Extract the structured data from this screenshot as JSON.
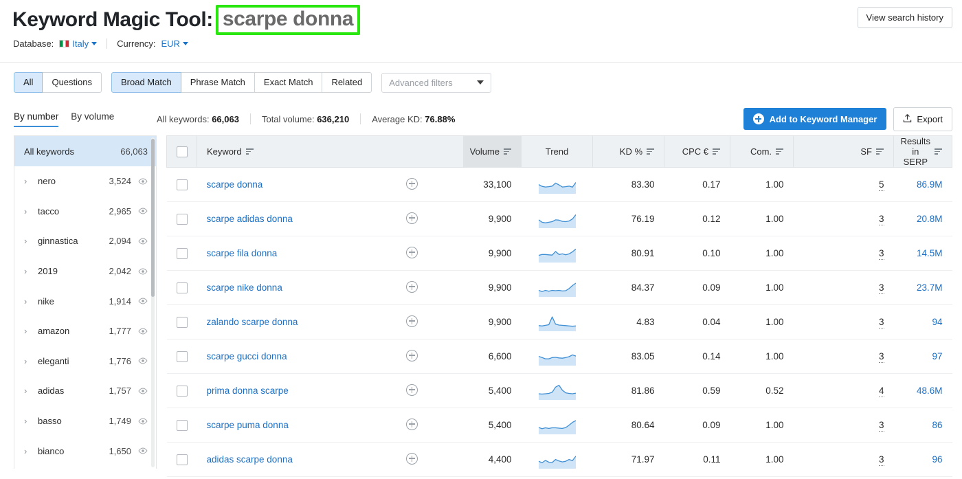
{
  "header": {
    "title_prefix": "Keyword Magic Tool:",
    "query": "scarpe donna",
    "view_history_label": "View search history",
    "highlight_color": "#2ae60f",
    "accent_color": "#1f80d8",
    "link_color": "#1b6fc4",
    "database_label": "Database:",
    "database_value": "Italy",
    "currency_label": "Currency:",
    "currency_value": "EUR"
  },
  "filters": {
    "group_one": [
      {
        "label": "All",
        "active": true
      },
      {
        "label": "Questions",
        "active": false
      }
    ],
    "group_two": [
      {
        "label": "Broad Match",
        "active": true
      },
      {
        "label": "Phrase Match",
        "active": false
      },
      {
        "label": "Exact Match",
        "active": false
      },
      {
        "label": "Related",
        "active": false
      }
    ],
    "advanced_filters_placeholder": "Advanced filters"
  },
  "stats": {
    "tabs": [
      {
        "label": "By number",
        "active": true
      },
      {
        "label": "By volume",
        "active": false
      }
    ],
    "all_keywords_label": "All keywords:",
    "all_keywords_value": "66,063",
    "total_volume_label": "Total volume:",
    "total_volume_value": "636,210",
    "average_kd_label": "Average KD:",
    "average_kd_value": "76.88%",
    "add_to_manager_label": "Add to Keyword Manager",
    "export_label": "Export"
  },
  "sidebar": {
    "all_label": "All keywords",
    "all_count": "66,063",
    "items": [
      {
        "label": "nero",
        "count": "3,524"
      },
      {
        "label": "tacco",
        "count": "2,965"
      },
      {
        "label": "ginnastica",
        "count": "2,094"
      },
      {
        "label": "2019",
        "count": "2,042"
      },
      {
        "label": "nike",
        "count": "1,914"
      },
      {
        "label": "amazon",
        "count": "1,777"
      },
      {
        "label": "eleganti",
        "count": "1,776"
      },
      {
        "label": "adidas",
        "count": "1,757"
      },
      {
        "label": "basso",
        "count": "1,749"
      },
      {
        "label": "bianco",
        "count": "1,650"
      }
    ]
  },
  "table": {
    "columns": [
      {
        "key": "keyword",
        "label": "Keyword",
        "sortable": true,
        "align": "left",
        "sorted": false
      },
      {
        "key": "volume",
        "label": "Volume",
        "sortable": true,
        "align": "right",
        "sorted": true
      },
      {
        "key": "trend",
        "label": "Trend",
        "sortable": false,
        "align": "center",
        "sorted": false
      },
      {
        "key": "kd",
        "label": "KD %",
        "sortable": true,
        "align": "right",
        "sorted": false
      },
      {
        "key": "cpc",
        "label": "CPC €",
        "sortable": true,
        "align": "right",
        "sorted": false
      },
      {
        "key": "com",
        "label": "Com.",
        "sortable": true,
        "align": "right",
        "sorted": false
      },
      {
        "key": "sf",
        "label": "SF",
        "sortable": true,
        "align": "right",
        "sorted": false
      },
      {
        "key": "serp",
        "label": "Results in SERP",
        "sortable": true,
        "align": "right",
        "sorted": false
      }
    ],
    "rows": [
      {
        "keyword": "scarpe donna",
        "volume": "33,100",
        "kd": "83.30",
        "cpc": "0.17",
        "com": "1.00",
        "sf": "5",
        "serp": "86.9M",
        "trend": [
          0.52,
          0.4,
          0.36,
          0.38,
          0.42,
          0.62,
          0.5,
          0.36,
          0.38,
          0.42,
          0.35,
          0.66
        ]
      },
      {
        "keyword": "scarpe adidas donna",
        "volume": "9,900",
        "kd": "76.19",
        "cpc": "0.12",
        "com": "1.00",
        "sf": "3",
        "serp": "20.8M",
        "trend": [
          0.46,
          0.3,
          0.26,
          0.3,
          0.34,
          0.46,
          0.44,
          0.36,
          0.34,
          0.38,
          0.52,
          0.8
        ]
      },
      {
        "keyword": "scarpe fila donna",
        "volume": "9,900",
        "kd": "80.91",
        "cpc": "0.10",
        "com": "1.00",
        "sf": "3",
        "serp": "14.5M",
        "trend": [
          0.38,
          0.44,
          0.44,
          0.42,
          0.4,
          0.64,
          0.44,
          0.48,
          0.42,
          0.48,
          0.62,
          0.8
        ]
      },
      {
        "keyword": "scarpe nike donna",
        "volume": "9,900",
        "kd": "84.37",
        "cpc": "0.09",
        "com": "1.00",
        "sf": "3",
        "serp": "23.7M",
        "trend": [
          0.34,
          0.26,
          0.34,
          0.28,
          0.34,
          0.32,
          0.34,
          0.3,
          0.32,
          0.46,
          0.66,
          0.82
        ]
      },
      {
        "keyword": "zalando scarpe donna",
        "volume": "9,900",
        "kd": "4.83",
        "cpc": "0.04",
        "com": "1.00",
        "sf": "3",
        "serp": "94",
        "trend": [
          0.28,
          0.26,
          0.3,
          0.34,
          0.86,
          0.38,
          0.32,
          0.3,
          0.28,
          0.26,
          0.24,
          0.26
        ]
      },
      {
        "keyword": "scarpe gucci donna",
        "volume": "6,600",
        "kd": "83.05",
        "cpc": "0.14",
        "com": "1.00",
        "sf": "3",
        "serp": "97",
        "trend": [
          0.52,
          0.44,
          0.36,
          0.36,
          0.44,
          0.46,
          0.42,
          0.4,
          0.44,
          0.5,
          0.62,
          0.54
        ]
      },
      {
        "keyword": "prima donna scarpe",
        "volume": "5,400",
        "kd": "81.86",
        "cpc": "0.59",
        "com": "0.52",
        "sf": "4",
        "serp": "48.6M",
        "trend": [
          0.32,
          0.3,
          0.32,
          0.34,
          0.42,
          0.76,
          0.88,
          0.56,
          0.38,
          0.34,
          0.32,
          0.36
        ]
      },
      {
        "keyword": "scarpe puma donna",
        "volume": "5,400",
        "kd": "80.64",
        "cpc": "0.09",
        "com": "1.00",
        "sf": "3",
        "serp": "86",
        "trend": [
          0.36,
          0.28,
          0.34,
          0.3,
          0.34,
          0.34,
          0.32,
          0.3,
          0.36,
          0.52,
          0.7,
          0.82
        ]
      },
      {
        "keyword": "adidas scarpe donna",
        "volume": "4,400",
        "kd": "71.97",
        "cpc": "0.11",
        "com": "1.00",
        "sf": "3",
        "serp": "96",
        "trend": [
          0.4,
          0.3,
          0.46,
          0.34,
          0.32,
          0.52,
          0.42,
          0.36,
          0.4,
          0.52,
          0.44,
          0.74
        ]
      }
    ]
  },
  "icons": {
    "eye": "eye-icon",
    "export": "export-icon",
    "plus": "plus-icon",
    "sort": "sort-icon"
  }
}
